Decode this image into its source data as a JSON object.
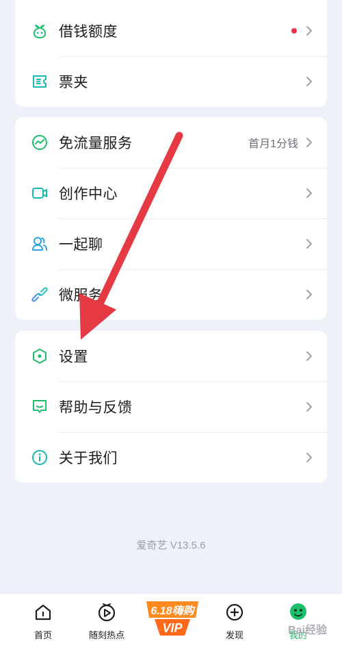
{
  "cards": [
    {
      "rows": [
        {
          "label": "借钱额度",
          "icon": "sprout-icon",
          "dot": true
        },
        {
          "label": "票夹",
          "icon": "ticket-icon"
        }
      ]
    },
    {
      "rows": [
        {
          "label": "免流量服务",
          "icon": "trend-circle-icon",
          "extra": "首月1分钱"
        },
        {
          "label": "创作中心",
          "icon": "video-camera-icon"
        },
        {
          "label": "一起聊",
          "icon": "people-icon"
        },
        {
          "label": "微服务",
          "icon": "link-icon"
        }
      ]
    },
    {
      "rows": [
        {
          "label": "设置",
          "icon": "settings-hexagon-icon"
        },
        {
          "label": "帮助与反馈",
          "icon": "feedback-icon"
        },
        {
          "label": "关于我们",
          "icon": "info-icon"
        }
      ]
    }
  ],
  "version": "爱奇艺 V13.5.6",
  "tabbar": {
    "items": [
      {
        "label": "首页",
        "icon": "home-icon"
      },
      {
        "label": "随刻热点",
        "icon": "play-circle-icon"
      },
      {
        "label": "",
        "icon": "vip-618-badge"
      },
      {
        "label": "发现",
        "icon": "plus-circle-icon"
      },
      {
        "label": "我的",
        "icon": "profile-icon"
      }
    ],
    "vip_badge_top": "6.18嗨购",
    "vip_badge_bottom": "VIP"
  },
  "watermark": "Bai经验",
  "colors": {
    "accent": "#1cc06a",
    "dot": "#e8324a",
    "arrow": "#e53a43"
  }
}
